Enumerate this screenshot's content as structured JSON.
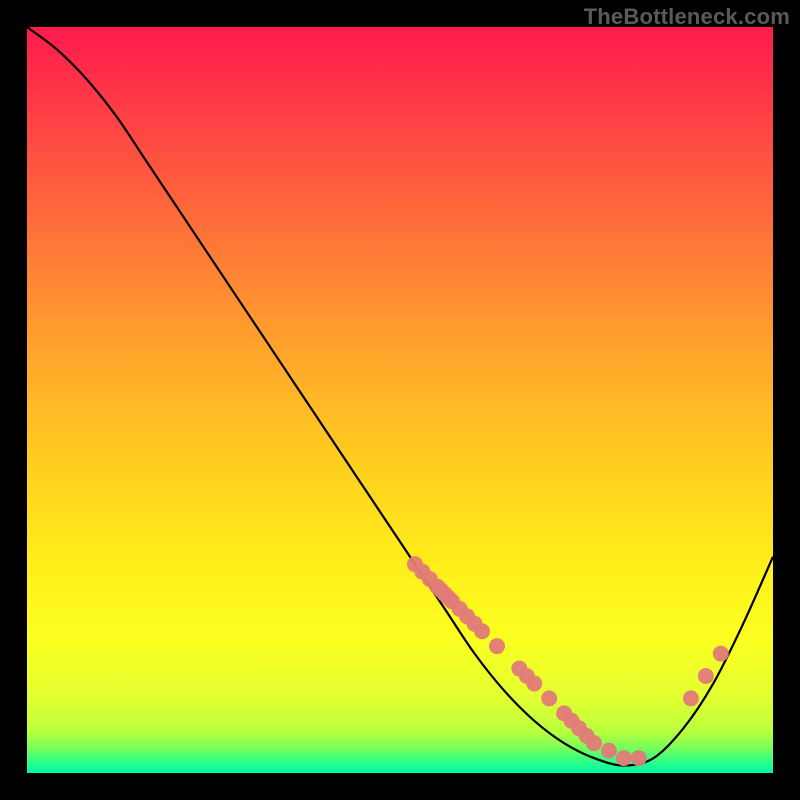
{
  "watermark": "TheBottleneck.com",
  "chart_data": {
    "type": "line",
    "title": "",
    "xlabel": "",
    "ylabel": "",
    "xlim": [
      0,
      100
    ],
    "ylim": [
      0,
      100
    ],
    "curve": {
      "x": [
        0,
        4,
        8,
        12,
        16,
        20,
        24,
        28,
        32,
        36,
        40,
        44,
        48,
        52,
        56,
        60,
        64,
        68,
        72,
        76,
        80,
        84,
        88,
        92,
        96,
        100
      ],
      "y": [
        100,
        97,
        93,
        88,
        82,
        76,
        70,
        64,
        58,
        52,
        46,
        40,
        34,
        28,
        22,
        16,
        11,
        7,
        4,
        2,
        1,
        2,
        6,
        12,
        20,
        29
      ]
    },
    "markers": {
      "x": [
        52,
        53,
        54,
        55,
        55.5,
        56,
        56.5,
        57,
        58,
        59,
        60,
        61,
        63,
        66,
        67,
        68,
        70,
        72,
        73,
        74,
        75,
        76,
        78,
        80,
        82,
        89,
        91,
        93
      ],
      "y": [
        28,
        27,
        26,
        25,
        24.5,
        24,
        23.5,
        23,
        22,
        21,
        20,
        19,
        17,
        14,
        13,
        12,
        10,
        8,
        7,
        6,
        5,
        4,
        3,
        2,
        2,
        10,
        13,
        16
      ],
      "color": "#e27b78",
      "radius": 8
    },
    "gradient_stops": [
      {
        "offset": 0.0,
        "color": "#ff1a4d"
      },
      {
        "offset": 0.1,
        "color": "#ff3a46"
      },
      {
        "offset": 0.22,
        "color": "#ff603d"
      },
      {
        "offset": 0.35,
        "color": "#ff8a33"
      },
      {
        "offset": 0.48,
        "color": "#ffb228"
      },
      {
        "offset": 0.6,
        "color": "#ffd21e"
      },
      {
        "offset": 0.72,
        "color": "#ffee1a"
      },
      {
        "offset": 0.82,
        "color": "#fbff1f"
      },
      {
        "offset": 0.9,
        "color": "#e2ff30"
      },
      {
        "offset": 0.945,
        "color": "#b8ff3e"
      },
      {
        "offset": 0.965,
        "color": "#7cff55"
      },
      {
        "offset": 0.985,
        "color": "#2dff88"
      },
      {
        "offset": 1.0,
        "color": "#00f7a8"
      }
    ]
  }
}
